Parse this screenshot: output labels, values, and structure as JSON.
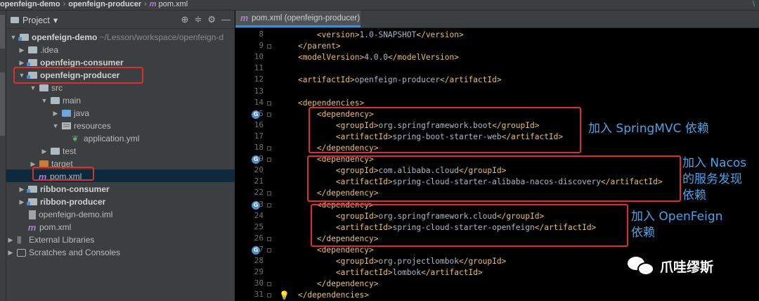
{
  "breadcrumb": {
    "items": [
      "openfeign-demo",
      "openfeign-producer",
      "pom.xml"
    ],
    "file_icon": "m-maven-icon",
    "right_glyph": "\\"
  },
  "project_panel": {
    "title": "Project",
    "dropdown_glyph": "▾",
    "tools": {
      "locate": "⊕",
      "collapse": "≑",
      "settings": "⚙",
      "hide": "—"
    },
    "tree": [
      {
        "label": "openfeign-demo",
        "suffix": "~/Lesson/workspace/openfeign-d",
        "bold": true
      },
      {
        "label": ".idea",
        "bold": false
      },
      {
        "label": "openfeign-consumer",
        "bold": true
      },
      {
        "label": "openfeign-producer",
        "bold": true
      },
      {
        "label": "src",
        "bold": false
      },
      {
        "label": "main",
        "bold": false
      },
      {
        "label": "java",
        "bold": false
      },
      {
        "label": "resources",
        "bold": false
      },
      {
        "label": "application.yml",
        "bold": false
      },
      {
        "label": "test",
        "bold": false
      },
      {
        "label": "target",
        "bold": false
      },
      {
        "label": "pom.xml",
        "bold": false
      },
      {
        "label": "ribbon-consumer",
        "bold": true
      },
      {
        "label": "ribbon-producer",
        "bold": true
      },
      {
        "label": "openfeign-demo.iml",
        "bold": false
      },
      {
        "label": "pom.xml",
        "bold": false
      },
      {
        "label": "External Libraries",
        "bold": false
      },
      {
        "label": "Scratches and Consoles",
        "bold": false
      }
    ]
  },
  "editor": {
    "tab_label": "pom.xml (openfeign-producer)",
    "line_numbers": [
      "8",
      "9",
      "10",
      "11",
      "12",
      "13",
      "14",
      "15",
      "16",
      "17",
      "18",
      "19",
      "20",
      "21",
      "22",
      "23",
      "24",
      "25",
      "26",
      "27",
      "28",
      "29",
      "30",
      "31"
    ],
    "lines": [
      {
        "indent": "        ",
        "parts": [
          [
            "tag",
            "<version>"
          ],
          [
            "text",
            "1.0-SNAPSHOT"
          ],
          [
            "tag",
            "</version>"
          ]
        ]
      },
      {
        "indent": "    ",
        "parts": [
          [
            "tag",
            "</parent>"
          ]
        ]
      },
      {
        "indent": "    ",
        "parts": [
          [
            "tag",
            "<modelVersion>"
          ],
          [
            "text",
            "4.0.0"
          ],
          [
            "tag",
            "</modelVersion>"
          ]
        ]
      },
      {
        "indent": "",
        "parts": []
      },
      {
        "indent": "    ",
        "parts": [
          [
            "tag",
            "<artifactId>"
          ],
          [
            "text",
            "openfeign-producer"
          ],
          [
            "tag",
            "</artifactId>"
          ]
        ]
      },
      {
        "indent": "",
        "parts": []
      },
      {
        "indent": "    ",
        "parts": [
          [
            "tag",
            "<dependencies>"
          ]
        ]
      },
      {
        "indent": "        ",
        "parts": [
          [
            "tag",
            "<dependency>"
          ]
        ]
      },
      {
        "indent": "            ",
        "parts": [
          [
            "tag",
            "<groupId>"
          ],
          [
            "text",
            "org.springframework.boot"
          ],
          [
            "tag",
            "</groupId>"
          ]
        ]
      },
      {
        "indent": "            ",
        "parts": [
          [
            "tag",
            "<artifactId>"
          ],
          [
            "text",
            "spring-boot-starter-web"
          ],
          [
            "tag",
            "</artifactId>"
          ]
        ]
      },
      {
        "indent": "        ",
        "parts": [
          [
            "tag",
            "</dependency>"
          ]
        ]
      },
      {
        "indent": "        ",
        "parts": [
          [
            "tag",
            "<dependency>"
          ]
        ]
      },
      {
        "indent": "            ",
        "parts": [
          [
            "tag",
            "<groupId>"
          ],
          [
            "text",
            "com.alibaba.cloud"
          ],
          [
            "tag",
            "</groupId>"
          ]
        ]
      },
      {
        "indent": "            ",
        "parts": [
          [
            "tag",
            "<artifactId>"
          ],
          [
            "text",
            "spring-cloud-starter-alibaba-nacos-discovery"
          ],
          [
            "tag",
            "</artifactId>"
          ]
        ]
      },
      {
        "indent": "        ",
        "parts": [
          [
            "tag",
            "</dependency>"
          ]
        ]
      },
      {
        "indent": "        ",
        "parts": [
          [
            "tag",
            "<dependency>"
          ]
        ]
      },
      {
        "indent": "            ",
        "parts": [
          [
            "tag",
            "<groupId>"
          ],
          [
            "text",
            "org.springframework.cloud"
          ],
          [
            "tag",
            "</groupId>"
          ]
        ]
      },
      {
        "indent": "            ",
        "parts": [
          [
            "tag",
            "<artifactId>"
          ],
          [
            "text",
            "spring-cloud-starter-openfeign"
          ],
          [
            "tag",
            "</artifactId>"
          ]
        ]
      },
      {
        "indent": "        ",
        "parts": [
          [
            "tag",
            "</dependency>"
          ]
        ]
      },
      {
        "indent": "        ",
        "parts": [
          [
            "tag",
            "<dependency>"
          ]
        ]
      },
      {
        "indent": "            ",
        "parts": [
          [
            "tag",
            "<groupId>"
          ],
          [
            "text",
            "org.projectlombok"
          ],
          [
            "tag",
            "</groupId>"
          ]
        ]
      },
      {
        "indent": "            ",
        "parts": [
          [
            "tag",
            "<artifactId>"
          ],
          [
            "text",
            "lombok"
          ],
          [
            "tag",
            "</artifactId>"
          ]
        ]
      },
      {
        "indent": "        ",
        "parts": [
          [
            "tag",
            "</dependency>"
          ]
        ]
      },
      {
        "indent": "    ",
        "parts": [
          [
            "tag",
            "</dependencies>"
          ]
        ]
      }
    ],
    "gutter_icon_lines": [
      "15",
      "19",
      "23",
      "27"
    ],
    "gutter_icon_glyph": "G",
    "bulb_glyph": "💡"
  },
  "annotations": {
    "springmvc": "加入 SpringMVC 依赖",
    "nacos_1": "加入 Nacos",
    "nacos_2": "的服务发现",
    "nacos_3": "依赖",
    "openfeign_1": "加入 OpenFeign",
    "openfeign_2": "依赖"
  },
  "watermark": {
    "text": "爪哇缪斯",
    "icon": "wechat-icon"
  },
  "colors": {
    "highlight_box": "#d9302c",
    "annotation_text": "#4aa3e8",
    "xml_tag": "#e8bf6a",
    "xml_text": "#a9b7c6",
    "panel_bg": "#3c3f41",
    "editor_bg": "#000000"
  }
}
